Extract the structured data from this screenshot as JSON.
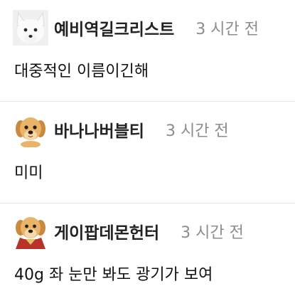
{
  "comments": [
    {
      "author": "예비역길크리스트",
      "time": "3 시간 전",
      "text": "대중적인 이름이긴해",
      "avatar_icon": "white-fox-avatar-icon"
    },
    {
      "author": "바나나버블티",
      "time": "3 시간 전",
      "text": "미미",
      "avatar_icon": "puppy-avatar-icon"
    },
    {
      "author": "게이팝데몬헌터",
      "time": "3 시간 전",
      "text": "40g 좌 눈만 봐도 광기가 보여",
      "avatar_icon": "puppy-red-cape-avatar-icon"
    }
  ]
}
